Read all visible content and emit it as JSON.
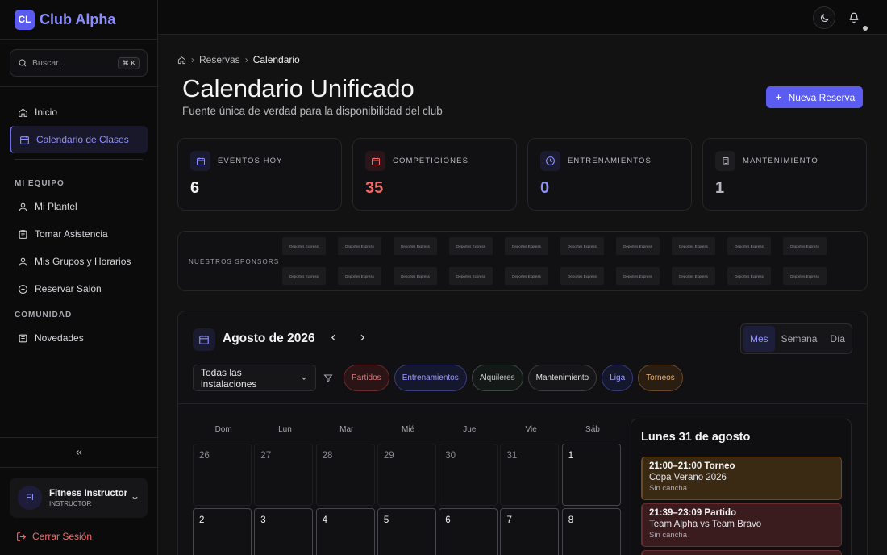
{
  "brand": {
    "logo_text": "CL",
    "name": "Club Alpha"
  },
  "search": {
    "placeholder": "Buscar...",
    "shortcut": "⌘ K"
  },
  "nav": {
    "items": [
      {
        "label": "Inicio",
        "icon": "home-icon"
      },
      {
        "label": "Calendario de Clases",
        "icon": "calendar-icon",
        "active": true
      }
    ],
    "section_team": "MI EQUIPO",
    "team_items": [
      {
        "label": "Mi Plantel",
        "icon": "user-icon"
      },
      {
        "label": "Tomar Asistencia",
        "icon": "clipboard-icon"
      },
      {
        "label": "Mis Grupos y Horarios",
        "icon": "user-icon"
      },
      {
        "label": "Reservar Salón",
        "icon": "plus-circle-icon"
      }
    ],
    "section_community": "COMUNIDAD",
    "community_items": [
      {
        "label": "Novedades",
        "icon": "newspaper-icon"
      }
    ]
  },
  "user": {
    "initials": "FI",
    "name": "Fitness Instructor",
    "role": "INSTRUCTOR"
  },
  "logout_label": "Cerrar Sesión",
  "breadcrumb": {
    "items": [
      "Reservas",
      "Calendario"
    ]
  },
  "page": {
    "title": "Calendario Unificado",
    "subtitle": "Fuente única de verdad para la disponibilidad del club",
    "new_button": "Nueva Reserva"
  },
  "stats": [
    {
      "label": "EVENTOS HOY",
      "value": "6",
      "color": "#f2f2f5",
      "icon": "calendar-icon"
    },
    {
      "label": "COMPETICIONES",
      "value": "35",
      "color": "#f26b6b",
      "icon": "calendar-icon"
    },
    {
      "label": "ENTRENAMIENTOS",
      "value": "0",
      "color": "#8f90ff",
      "icon": "clock-icon"
    },
    {
      "label": "MANTENIMIENTO",
      "value": "1",
      "color": "#b8b8be",
      "icon": "building-icon"
    }
  ],
  "sponsors": {
    "label": "NUESTROS SPONSORS",
    "logo_text": "Deportes Express",
    "count": 20
  },
  "calendar": {
    "month": "Agosto de 2026",
    "views": [
      "Mes",
      "Semana",
      "Día"
    ],
    "active_view": "Mes",
    "facility": "Todas las instalaciones",
    "filters": [
      {
        "label": "Partidos",
        "color": "#e07575",
        "bg": "#2a1416",
        "border": "#6a2a2e"
      },
      {
        "label": "Entrenamientos",
        "color": "#9a9bff",
        "bg": "#15172c",
        "border": "#3a3d7a"
      },
      {
        "label": "Alquileres",
        "color": "#c4c8c4",
        "bg": "#141816",
        "border": "#3a4a42"
      },
      {
        "label": "Mantenimiento",
        "color": "#e0e0e4",
        "bg": "#161618",
        "border": "#3d3d42"
      },
      {
        "label": "Liga",
        "color": "#9a9bff",
        "bg": "#15172c",
        "border": "#3a3d7a"
      },
      {
        "label": "Torneos",
        "color": "#e8b27a",
        "bg": "#2a1d12",
        "border": "#6b4a2a"
      }
    ],
    "weekdays": [
      "Dom",
      "Lun",
      "Mar",
      "Mié",
      "Jue",
      "Vie",
      "Sáb"
    ],
    "days": [
      {
        "n": "26",
        "in": false
      },
      {
        "n": "27",
        "in": false
      },
      {
        "n": "28",
        "in": false
      },
      {
        "n": "29",
        "in": false
      },
      {
        "n": "30",
        "in": false
      },
      {
        "n": "31",
        "in": false
      },
      {
        "n": "1",
        "in": true
      },
      {
        "n": "2",
        "in": true
      },
      {
        "n": "3",
        "in": true
      },
      {
        "n": "4",
        "in": true
      },
      {
        "n": "5",
        "in": true
      },
      {
        "n": "6",
        "in": true
      },
      {
        "n": "7",
        "in": true
      },
      {
        "n": "8",
        "in": true
      }
    ]
  },
  "day_panel": {
    "title": "Lunes 31 de agosto",
    "events": [
      {
        "time_type": "21:00–21:00 Torneo",
        "title": "Copa Verano 2026",
        "place": "Sin cancha",
        "bg": "#3a2a14",
        "border": "#6b4a24"
      },
      {
        "time_type": "21:39–23:09 Partido",
        "title": "Team Alpha vs Team Bravo",
        "place": "Sin cancha",
        "bg": "#3a1c1e",
        "border": "#6a2a2e"
      },
      {
        "time_type": "",
        "title": "",
        "place": "",
        "bg": "#3a1c1e",
        "border": "#6a2a2e"
      }
    ]
  }
}
